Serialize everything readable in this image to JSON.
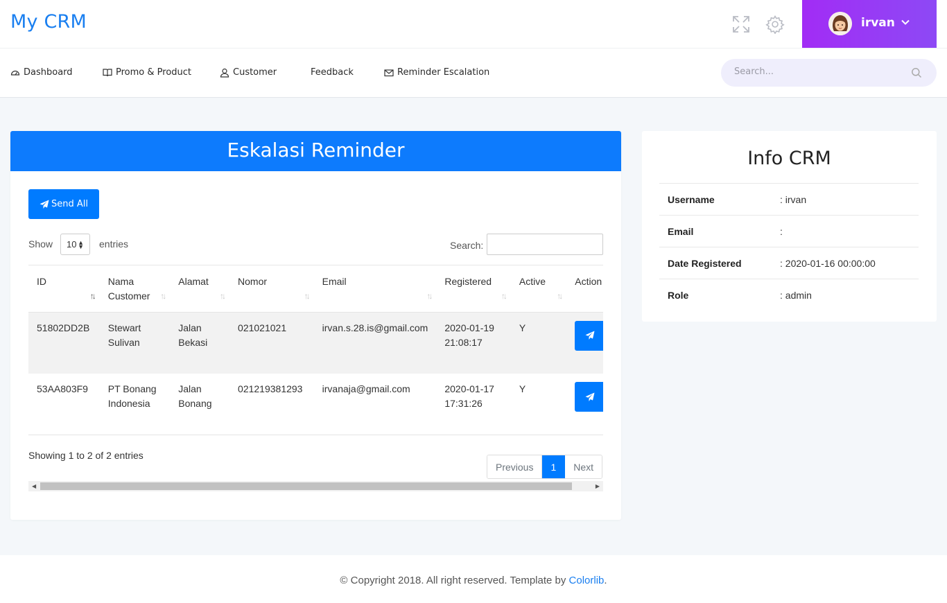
{
  "app": {
    "brand": "My CRM"
  },
  "header": {
    "user_name": "irvan"
  },
  "nav": {
    "items": [
      {
        "label": "Dashboard",
        "icon": "dashboard-icon"
      },
      {
        "label": "Promo & Product",
        "icon": "book-icon"
      },
      {
        "label": "Customer",
        "icon": "user-icon"
      },
      {
        "label": "Feedback",
        "icon": ""
      },
      {
        "label": "Reminder Escalation",
        "icon": "envelope-icon"
      }
    ],
    "search_placeholder": "Search..."
  },
  "main": {
    "title": "Eskalasi Reminder",
    "send_all_label": "Send All",
    "show_label": "Show",
    "entries_value": "10",
    "entries_label": "entries",
    "search_label": "Search:",
    "columns": [
      "ID",
      "Nama Customer",
      "Alamat",
      "Nomor",
      "Email",
      "Registered",
      "Active",
      "Action"
    ],
    "rows": [
      {
        "id": "51802DD2B",
        "nama": "Stewart Sulivan",
        "alamat": "Jalan Bekasi",
        "nomor": "021021021",
        "email": "irvan.s.28.is@gmail.com",
        "registered": "2020-01-19 21:08:17",
        "active": "Y"
      },
      {
        "id": "53AA803F9",
        "nama": "PT Bonang Indonesia",
        "alamat": "Jalan Bonang",
        "nomor": "021219381293",
        "email": "irvanaja@gmail.com",
        "registered": "2020-01-17 17:31:26",
        "active": "Y"
      }
    ],
    "info_text": "Showing 1 to 2 of 2 entries",
    "pager": {
      "previous": "Previous",
      "current": "1",
      "next": "Next"
    }
  },
  "info": {
    "title": "Info CRM",
    "rows": [
      {
        "key": "Username",
        "value": ": irvan"
      },
      {
        "key": "Email",
        "value": ":"
      },
      {
        "key": "Date Registered",
        "value": ": 2020-01-16 00:00:00"
      },
      {
        "key": "Role",
        "value": ": admin"
      }
    ]
  },
  "footer": {
    "text": "© Copyright 2018. All right reserved. Template by ",
    "link": "Colorlib",
    "suffix": "."
  },
  "colors": {
    "brand": "#1a7ff0",
    "primary": "#007bff",
    "header_gradient_start": "#a22cf5",
    "header_gradient_end": "#8d49f5"
  }
}
